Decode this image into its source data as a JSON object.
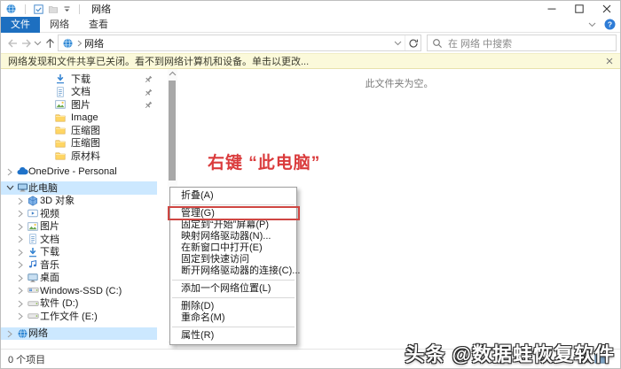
{
  "window": {
    "title": "网络"
  },
  "ribbon": {
    "tabs": [
      {
        "label": "文件",
        "active": true
      },
      {
        "label": "网络",
        "active": false
      },
      {
        "label": "查看",
        "active": false
      }
    ]
  },
  "addressbar": {
    "path": "网络",
    "search_placeholder": "在 网络 中搜索"
  },
  "notification": {
    "text": "网络发现和文件共享已关闭。看不到网络计算机和设备。单击以更改..."
  },
  "sidebar": {
    "rows": [
      {
        "label": "下载",
        "icon": "download",
        "indent": "quick",
        "pin": true
      },
      {
        "label": "文档",
        "icon": "document",
        "indent": "quick",
        "pin": true
      },
      {
        "label": "图片",
        "icon": "picture",
        "indent": "quick",
        "pin": true
      },
      {
        "label": "Image",
        "icon": "folder",
        "indent": "quick"
      },
      {
        "label": "压缩图",
        "icon": "folder",
        "indent": "quick"
      },
      {
        "label": "压缩图",
        "icon": "folder",
        "indent": "quick"
      },
      {
        "label": "原材料",
        "icon": "folder",
        "indent": "quick"
      },
      {
        "label": "OneDrive - Personal",
        "icon": "cloud",
        "indent": "root",
        "expander": "right",
        "gap": 3
      },
      {
        "label": "此电脑",
        "icon": "pc",
        "indent": "root",
        "expander": "down",
        "selected": true,
        "gap": 4
      },
      {
        "label": "3D 对象",
        "icon": "cube",
        "indent": "child",
        "expander": "right"
      },
      {
        "label": "视频",
        "icon": "video",
        "indent": "child",
        "expander": "right"
      },
      {
        "label": "图片",
        "icon": "picture",
        "indent": "child",
        "expander": "right"
      },
      {
        "label": "文档",
        "icon": "document",
        "indent": "child",
        "expander": "right"
      },
      {
        "label": "下载",
        "icon": "download",
        "indent": "child",
        "expander": "right"
      },
      {
        "label": "音乐",
        "icon": "music",
        "indent": "child",
        "expander": "right"
      },
      {
        "label": "桌面",
        "icon": "desktop",
        "indent": "child",
        "expander": "right"
      },
      {
        "label": "Windows-SSD (C:)",
        "icon": "driveOs",
        "indent": "child",
        "expander": "right"
      },
      {
        "label": "软件 (D:)",
        "icon": "drive",
        "indent": "child",
        "expander": "right"
      },
      {
        "label": "工作文件 (E:)",
        "icon": "drive",
        "indent": "child",
        "expander": "right"
      },
      {
        "label": "网络",
        "icon": "network",
        "indent": "root",
        "expander": "right",
        "selected": true,
        "gap": 5
      }
    ]
  },
  "content": {
    "empty_text": "此文件夹为空。",
    "annotation": "右键 “此电脑”"
  },
  "context_menu": {
    "items": [
      {
        "label": "折叠(A)"
      },
      {
        "separator": true
      },
      {
        "label": "管理(G)",
        "annotated": true
      },
      {
        "label": "固定到“开始”屏幕(P)"
      },
      {
        "label": "映射网络驱动器(N)..."
      },
      {
        "label": "在新窗口中打开(E)"
      },
      {
        "label": "固定到快速访问"
      },
      {
        "label": "断开网络驱动器的连接(C)..."
      },
      {
        "separator": true
      },
      {
        "label": "添加一个网络位置(L)"
      },
      {
        "separator": true
      },
      {
        "label": "删除(D)"
      },
      {
        "label": "重命名(M)"
      },
      {
        "separator": true
      },
      {
        "label": "属性(R)"
      }
    ]
  },
  "statusbar": {
    "items_count": "0 个项目"
  },
  "watermark": {
    "text": "头条 @数据蛙恢复软件"
  },
  "colors": {
    "accent_blue": "#1d6fc0",
    "selection_blue": "#cce8ff",
    "annotation_red": "#da3b3c",
    "infobar_bg": "#fbf9da",
    "menu_border": "#9e9e9e"
  }
}
